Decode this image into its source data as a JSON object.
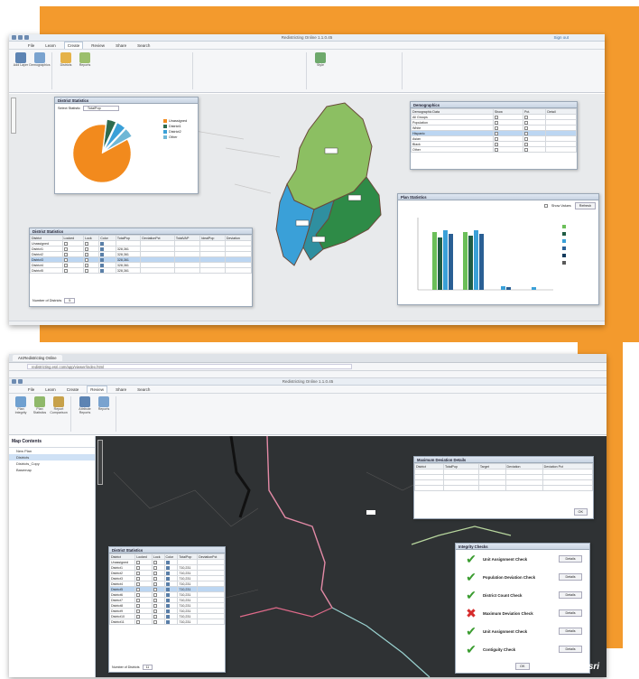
{
  "colors": {
    "accent_orange": "#f39a2d",
    "county_light_green": "#8cbf62",
    "county_dark_green": "#2e8b47",
    "county_blue": "#3aa0d8",
    "county_teal": "#2f8fa0",
    "pie_orange": "#f28a1d",
    "check_green": "#3a9c2f",
    "error_red": "#d62c2c"
  },
  "top": {
    "window_title": "Redistricting Online 1.1.0.45",
    "sign_in": "Sign out",
    "menu": [
      "File",
      "Learn",
      "Create",
      "Review",
      "Share",
      "Search"
    ],
    "ribbon_buttons": [
      {
        "label": "Add Layer",
        "icon": "layer-icon"
      },
      {
        "label": "Demographics",
        "icon": "people-icon"
      },
      {
        "label": "Districts",
        "icon": "districts-icon"
      },
      {
        "label": "Reports",
        "icon": "reports-icon"
      },
      {
        "label": "Style",
        "icon": "style-icon"
      }
    ],
    "district_stats": {
      "title": "District Statistics",
      "field_label": "Select Statistic",
      "field_value": "TotalPop",
      "legend": [
        {
          "label": "Unassigned",
          "color": "#f28a1d"
        },
        {
          "label": "District1",
          "color": "#2e6b4f"
        },
        {
          "label": "District2",
          "color": "#3aa0d8"
        },
        {
          "label": "Other",
          "color": "#6fb7d6"
        }
      ],
      "pie_values": [
        0.85,
        0.05,
        0.05,
        0.05
      ]
    },
    "demographics": {
      "title": "Demographics",
      "headers": [
        "Demographic Data",
        "Show",
        "Pct.",
        "Detail"
      ],
      "rows": [
        "All Groups",
        "Population",
        "White",
        "Hispanic",
        "Asian",
        "Black",
        "Other"
      ]
    },
    "districts_table": {
      "title": "District Statistics",
      "headers": [
        "District",
        "Locked",
        "Lock",
        "Color",
        "TotalPop",
        "DeviationPct",
        "TotalVAP",
        "IdealPop",
        "Deviation"
      ],
      "rows": [
        [
          "Unassigned",
          "",
          "",
          "",
          "",
          "",
          "",
          "",
          ""
        ],
        [
          "District1",
          "",
          "",
          "",
          "328,361",
          "",
          "",
          "",
          ""
        ],
        [
          "District2",
          "",
          "",
          "",
          "328,361",
          "",
          "",
          "",
          ""
        ],
        [
          "District3",
          "",
          "",
          "",
          "328,361",
          "",
          "",
          "",
          ""
        ],
        [
          "District4",
          "",
          "",
          "",
          "328,361",
          "",
          "",
          "",
          ""
        ],
        [
          "District5",
          "",
          "",
          "",
          "328,361",
          "",
          "",
          "",
          ""
        ]
      ],
      "footer_label": "Number of Districts",
      "footer_value": "5"
    },
    "bar_chart": {
      "title": "Plan Statistics",
      "show_label": "Show Values",
      "button": "Refresh"
    }
  },
  "bottom": {
    "tab_label": "ArcRedistricting Online",
    "url": "redistricting.esri.com/app/viewer/index.html",
    "window_title": "Redistricting Online 1.1.0.45",
    "menu": [
      "File",
      "Learn",
      "Create",
      "Review",
      "Share",
      "Search"
    ],
    "ribbon_buttons": [
      {
        "label": "Plan Integrity",
        "icon": "plan-icon"
      },
      {
        "label": "Plan Statistics",
        "icon": "stats-icon"
      },
      {
        "label": "Report Comparison",
        "icon": "compare-icon"
      },
      {
        "label": "Attribute Reports",
        "icon": "attribute-icon"
      },
      {
        "label": "Reports",
        "icon": "report-icon"
      }
    ],
    "toc": {
      "title": "Map Contents",
      "items": [
        "New Plan",
        "Districts",
        "Districts_Copy",
        "Basemap"
      ]
    },
    "district_stats": {
      "title": "District Statistics",
      "headers": [
        "District",
        "Locked",
        "Lock",
        "Color",
        "TotalPop",
        "DeviationPct"
      ],
      "rows": [
        [
          "Unassigned",
          "",
          "",
          "",
          "",
          ""
        ],
        [
          "District1",
          "",
          "",
          "",
          "710,231",
          ""
        ],
        [
          "District2",
          "",
          "",
          "",
          "710,231",
          ""
        ],
        [
          "District3",
          "",
          "",
          "",
          "710,231",
          ""
        ],
        [
          "District4",
          "",
          "",
          "",
          "710,231",
          ""
        ],
        [
          "District5",
          "",
          "",
          "",
          "710,231",
          ""
        ],
        [
          "District6",
          "",
          "",
          "",
          "710,231",
          ""
        ],
        [
          "District7",
          "",
          "",
          "",
          "710,231",
          ""
        ],
        [
          "District8",
          "",
          "",
          "",
          "710,231",
          ""
        ],
        [
          "District9",
          "",
          "",
          "",
          "710,231",
          ""
        ],
        [
          "District10",
          "",
          "",
          "",
          "710,231",
          ""
        ],
        [
          "District11",
          "",
          "",
          "",
          "710,231",
          ""
        ]
      ],
      "footer_label": "Number of Districts",
      "footer_value": "11"
    },
    "details_panel": {
      "title": "Maximum Deviation Details",
      "headers": [
        "District",
        "TotalPop",
        "Target",
        "Deviation",
        "Deviation Pct"
      ],
      "rows": [
        [
          "",
          "",
          "",
          "",
          ""
        ],
        [
          "",
          "",
          "",
          "",
          ""
        ],
        [
          "",
          "",
          "",
          "",
          ""
        ],
        [
          "",
          "",
          "",
          "",
          ""
        ]
      ],
      "button": "OK"
    },
    "checks": {
      "title": "Integrity Checks",
      "items": [
        {
          "label": "Unit Assignment Check",
          "status": "pass",
          "button": "Details"
        },
        {
          "label": "Population Deviation Check",
          "status": "pass",
          "button": "Details"
        },
        {
          "label": "District Count Check",
          "status": "pass",
          "button": "Details"
        },
        {
          "label": "Maximum Deviation Check",
          "status": "fail",
          "button": "Details"
        },
        {
          "label": "Unit Assignment Check",
          "status": "pass",
          "button": "Details"
        },
        {
          "label": "Contiguity Check",
          "status": "pass",
          "button": "Details"
        }
      ],
      "ok_button": "OK"
    },
    "esri_label": "esri"
  }
}
